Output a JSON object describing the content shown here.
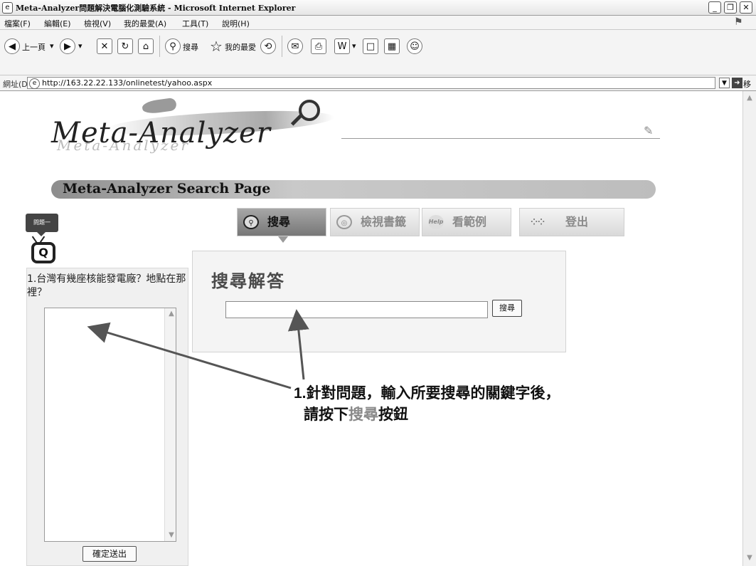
{
  "window": {
    "title": "Meta-Analyzer問題解決電腦化測驗系統 - Microsoft Internet Explorer",
    "icon_glyph": "e"
  },
  "menubar": {
    "items": [
      "檔案(F)",
      "編輯(E)",
      "檢視(V)",
      "我的最愛(A)",
      "工具(T)",
      "說明(H)"
    ]
  },
  "toolbar": {
    "back_label": "上一頁",
    "search_label": "搜尋",
    "favorites_label": "我的最愛"
  },
  "addressbar": {
    "label": "網址(D)",
    "url": "http://163.22.22.133/onlinetest/yahoo.aspx",
    "go_label": "移至"
  },
  "page": {
    "logo_text": "Meta-Analyzer",
    "banner_title": "Meta-Analyzer Search Page",
    "question_tag": "問題一",
    "question_text": "1.台灣有幾座核能發電廠？地點在那裡？",
    "submit_label": "確定送出",
    "tabs": [
      {
        "label": "搜尋",
        "icon": "search-icon",
        "active": true
      },
      {
        "label": "檢視書籤",
        "icon": "bookmark-icon",
        "active": false
      },
      {
        "label": "看範例",
        "icon": "help-icon",
        "active": false
      },
      {
        "label": "登出",
        "icon": "logout-icon",
        "active": false
      }
    ],
    "search_heading": "搜尋解答",
    "search_input_value": "",
    "search_button_label": "搜尋"
  },
  "annotation": {
    "line1": "1.針對問題，輸入所要搜尋的關鍵字後，",
    "line2_prefix": "請按下",
    "line2_highlight": "搜尋",
    "line2_suffix": "按鈕"
  },
  "colors": {
    "annotation_highlight": "#888888",
    "active_tab": "#777777"
  }
}
